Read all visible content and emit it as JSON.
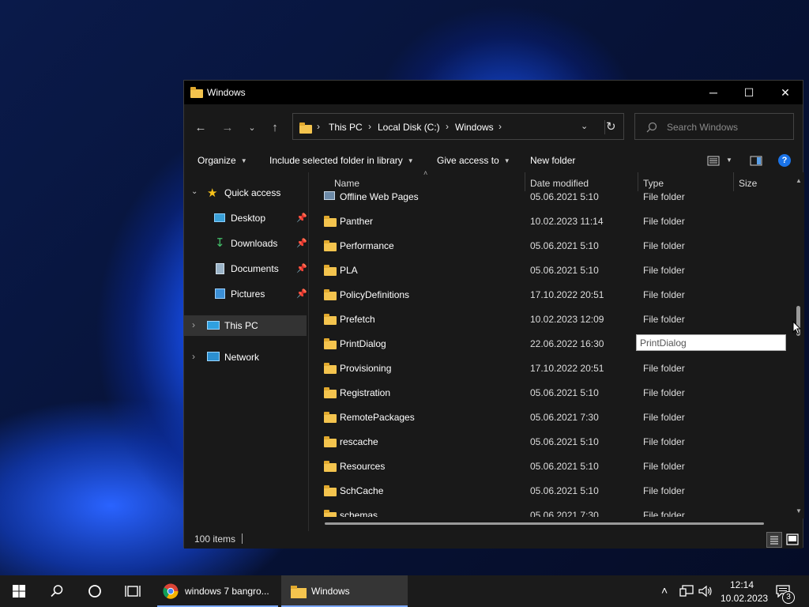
{
  "window": {
    "title": "Windows",
    "controls": {
      "minimize": "─",
      "maximize": "☐",
      "close": "✕"
    }
  },
  "address": {
    "crumbs": [
      "This PC",
      "Local Disk (C:)",
      "Windows"
    ]
  },
  "search": {
    "placeholder": "Search Windows"
  },
  "toolbar": {
    "organize": "Organize",
    "include_library": "Include selected folder in library",
    "give_access": "Give access to",
    "new_folder": "New folder"
  },
  "nav_pane": {
    "quick_access": "Quick access",
    "items": [
      {
        "label": "Desktop",
        "icon": "desktop-icon"
      },
      {
        "label": "Downloads",
        "icon": "downloads-icon"
      },
      {
        "label": "Documents",
        "icon": "documents-icon"
      },
      {
        "label": "Pictures",
        "icon": "pictures-icon"
      }
    ],
    "this_pc": "This PC",
    "network": "Network"
  },
  "columns": {
    "name": "Name",
    "date": "Date modified",
    "type": "Type",
    "size": "Size"
  },
  "files": [
    {
      "name": "Offline Web Pages",
      "date": "05.06.2021 5:10",
      "type": "File folder"
    },
    {
      "name": "Panther",
      "date": "10.02.2023 11:14",
      "type": "File folder"
    },
    {
      "name": "Performance",
      "date": "05.06.2021 5:10",
      "type": "File folder"
    },
    {
      "name": "PLA",
      "date": "05.06.2021 5:10",
      "type": "File folder"
    },
    {
      "name": "PolicyDefinitions",
      "date": "17.10.2022 20:51",
      "type": "File folder"
    },
    {
      "name": "Prefetch",
      "date": "10.02.2023 12:09",
      "type": "File folder"
    },
    {
      "name": "PrintDialog",
      "date": "22.06.2022 16:30",
      "type": ""
    },
    {
      "name": "Provisioning",
      "date": "17.10.2022 20:51",
      "type": "File folder"
    },
    {
      "name": "Registration",
      "date": "05.06.2021 5:10",
      "type": "File folder"
    },
    {
      "name": "RemotePackages",
      "date": "05.06.2021 7:30",
      "type": "File folder"
    },
    {
      "name": "rescache",
      "date": "05.06.2021 5:10",
      "type": "File folder"
    },
    {
      "name": "Resources",
      "date": "05.06.2021 5:10",
      "type": "File folder"
    },
    {
      "name": "SchCache",
      "date": "05.06.2021 5:10",
      "type": "File folder"
    },
    {
      "name": "schemas",
      "date": "05.06.2021 7:30",
      "type": "File folder"
    }
  ],
  "tooltip": "PrintDialog",
  "status": {
    "items": "100 items"
  },
  "taskbar": {
    "chrome_label": "windows 7 bangro...",
    "explorer_label": "Windows",
    "time": "12:14",
    "date": "10.02.2023",
    "notifications": "3"
  },
  "colors": {
    "accent": "#0078d4",
    "folder": "#f4c44e",
    "window_bg": "#191919"
  }
}
